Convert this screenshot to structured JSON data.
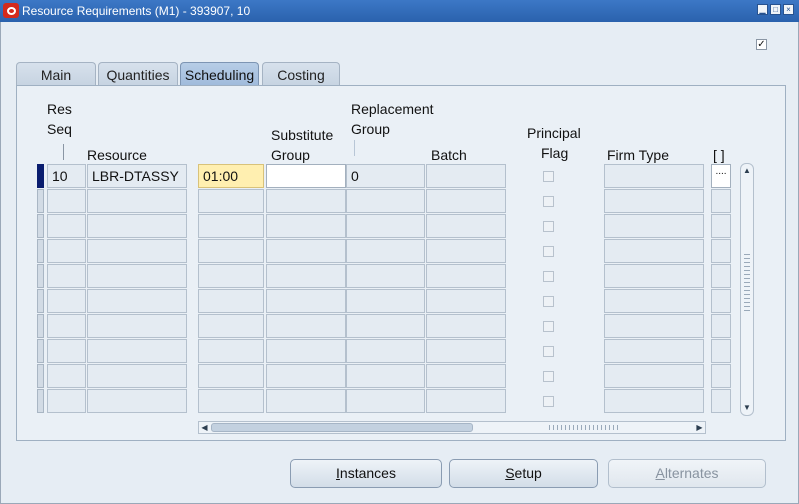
{
  "window": {
    "title": "Resource Requirements (M1) - 393907, 10",
    "minimize_glyph": "▁",
    "maximize_glyph": "□",
    "close_glyph": "×",
    "top_checkbox": "✓"
  },
  "tabs": [
    {
      "label": "Main",
      "active": false
    },
    {
      "label": "Quantities",
      "active": false
    },
    {
      "label": "Scheduling",
      "active": true
    },
    {
      "label": "Costing",
      "active": false
    }
  ],
  "columns": {
    "res_seq_line1": "Res",
    "res_seq_line2": "Seq",
    "resource": "Resource",
    "substitute_line1": "Substitute",
    "substitute_line2": "Group",
    "replacement_line1": "Replacement",
    "replacement_line2": "Group",
    "batch": "Batch",
    "principal_line1": "Principal",
    "principal_line2": "Flag",
    "firm_type": "Firm Type",
    "bracket": "[ ]"
  },
  "rows": [
    {
      "res_seq": "10",
      "resource": "LBR-DTASSY",
      "time": "01:00",
      "substitute_group": "",
      "replacement_group": "0",
      "batch": "",
      "firm_type": "",
      "more": "...."
    }
  ],
  "empty_row_count": 9,
  "buttons": {
    "instances": {
      "prefix": "",
      "underline": "I",
      "rest": "nstances"
    },
    "setup": {
      "prefix": "",
      "underline": "S",
      "rest": "etup"
    },
    "alternates": {
      "prefix": "",
      "underline": "A",
      "rest": "lternates"
    }
  },
  "scroll_glyphs": {
    "up": "▲",
    "down": "▼",
    "left": "◀",
    "right": "▶"
  }
}
